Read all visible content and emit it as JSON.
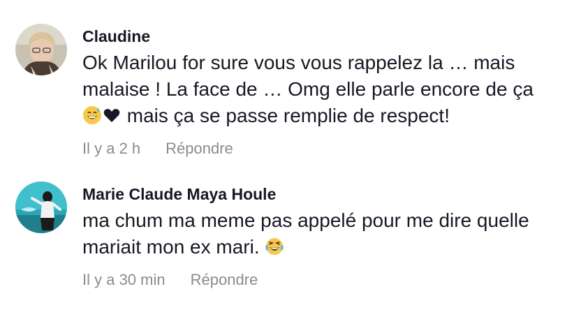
{
  "comments": [
    {
      "username": "Claudine",
      "text_line1": "Ok Marilou for sure vous vous rappelez la … mais",
      "text_line2": "malaise ! La face de … Omg elle parle encore de ça",
      "text_line3": " mais ça se passe remplie de respect!",
      "timestamp": "Il y a 2 h",
      "reply_label": "Répondre",
      "emojis": [
        "grinning-sweat-emoji",
        "black-heart-emoji"
      ]
    },
    {
      "username": "Marie Claude Maya Houle",
      "text_line1": "ma chum ma meme pas appelé pour me dire quelle",
      "text_line2": "mariait mon ex mari. ",
      "timestamp": "Il y a 30 min",
      "reply_label": "Répondre",
      "emojis": [
        "tears-of-joy-emoji"
      ]
    }
  ],
  "colors": {
    "text": "#161823",
    "meta": "#8a8b91",
    "background": "#ffffff"
  }
}
